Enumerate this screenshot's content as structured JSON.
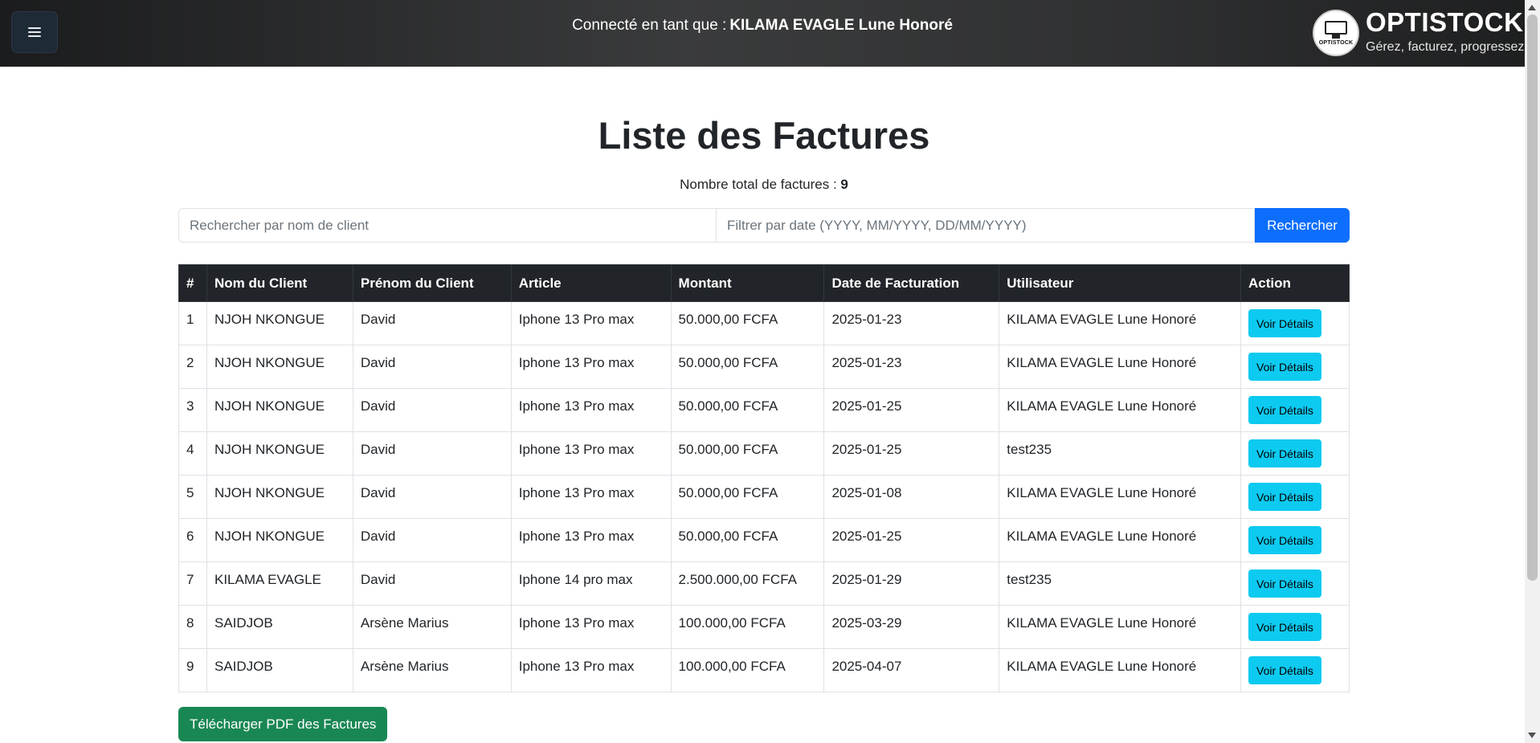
{
  "navbar": {
    "menu_icon": "hamburger-menu-icon",
    "connected_prefix": "Connecté en tant que :",
    "connected_user": "KILAMA EVAGLE Lune Honoré",
    "brand_name": "OPTISTOCK",
    "brand_tagline": "Gérez, facturez, progressez",
    "logo_mini_text": "OPTISTOCK"
  },
  "page": {
    "title": "Liste des Factures",
    "total_label": "Nombre total de factures :",
    "total_value": "9"
  },
  "search": {
    "client_placeholder": "Rechercher par nom de client",
    "date_placeholder": "Filtrer par date (YYYY, MM/YYYY, DD/MM/YYYY)",
    "button_label": "Rechercher"
  },
  "table": {
    "headers": [
      "#",
      "Nom du Client",
      "Prénom du Client",
      "Article",
      "Montant",
      "Date de Facturation",
      "Utilisateur",
      "Action"
    ],
    "rows": [
      {
        "num": "1",
        "nom": "NJOH NKONGUE",
        "prenom": "David",
        "article": "Iphone 13 Pro max",
        "montant": "50.000,00 FCFA",
        "date": "2025-01-23",
        "utilisateur": "KILAMA EVAGLE Lune Honoré",
        "action": "Voir Détails"
      },
      {
        "num": "2",
        "nom": "NJOH NKONGUE",
        "prenom": "David",
        "article": "Iphone 13 Pro max",
        "montant": "50.000,00 FCFA",
        "date": "2025-01-23",
        "utilisateur": "KILAMA EVAGLE Lune Honoré",
        "action": "Voir Détails"
      },
      {
        "num": "3",
        "nom": "NJOH NKONGUE",
        "prenom": "David",
        "article": "Iphone 13 Pro max",
        "montant": "50.000,00 FCFA",
        "date": "2025-01-25",
        "utilisateur": "KILAMA EVAGLE Lune Honoré",
        "action": "Voir Détails"
      },
      {
        "num": "4",
        "nom": "NJOH NKONGUE",
        "prenom": "David",
        "article": "Iphone 13 Pro max",
        "montant": "50.000,00 FCFA",
        "date": "2025-01-25",
        "utilisateur": "test235",
        "action": "Voir Détails"
      },
      {
        "num": "5",
        "nom": "NJOH NKONGUE",
        "prenom": "David",
        "article": "Iphone 13 Pro max",
        "montant": "50.000,00 FCFA",
        "date": "2025-01-08",
        "utilisateur": "KILAMA EVAGLE Lune Honoré",
        "action": "Voir Détails"
      },
      {
        "num": "6",
        "nom": "NJOH NKONGUE",
        "prenom": "David",
        "article": "Iphone 13 Pro max",
        "montant": "50.000,00 FCFA",
        "date": "2025-01-25",
        "utilisateur": "KILAMA EVAGLE Lune Honoré",
        "action": "Voir Détails"
      },
      {
        "num": "7",
        "nom": "KILAMA EVAGLE",
        "prenom": "David",
        "article": "Iphone 14 pro max",
        "montant": "2.500.000,00 FCFA",
        "date": "2025-01-29",
        "utilisateur": "test235",
        "action": "Voir Détails"
      },
      {
        "num": "8",
        "nom": "SAIDJOB",
        "prenom": "Arsène Marius",
        "article": "Iphone 13 Pro max",
        "montant": "100.000,00 FCFA",
        "date": "2025-03-29",
        "utilisateur": "KILAMA EVAGLE Lune Honoré",
        "action": "Voir Détails"
      },
      {
        "num": "9",
        "nom": "SAIDJOB",
        "prenom": "Arsène Marius",
        "article": "Iphone 13 Pro max",
        "montant": "100.000,00 FCFA",
        "date": "2025-04-07",
        "utilisateur": "KILAMA EVAGLE Lune Honoré",
        "action": "Voir Détails"
      }
    ]
  },
  "actions": {
    "pdf_label": "Télécharger PDF des Factures"
  },
  "colors": {
    "primary": "#0d6efd",
    "info": "#0dcaf0",
    "success": "#198754",
    "dark": "#212529"
  }
}
